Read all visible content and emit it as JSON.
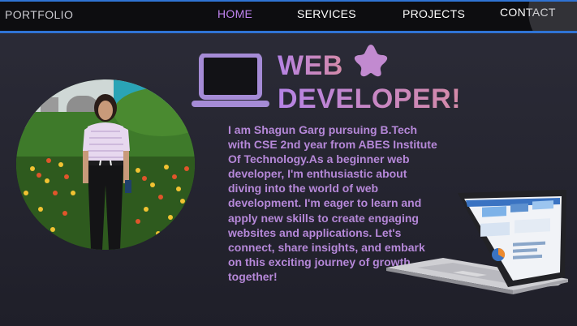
{
  "navbar": {
    "brand": "PORTFOLIO",
    "links": [
      {
        "label": "HOME",
        "active": true
      },
      {
        "label": "SERVICES",
        "active": false
      },
      {
        "label": "PROJECTS",
        "active": false
      },
      {
        "label": "CONTACT",
        "active": false
      }
    ],
    "border_color": "#2f73d4",
    "active_color": "#c084f0"
  },
  "hero": {
    "headline_line1": "WEB",
    "headline_line2": "DEVELOPER!",
    "bio": "I am Shagun Garg pursuing B.Tech with CSE 2nd year from ABES Institute Of Technology.As a beginner web developer, I'm enthusiastic about diving into the world of web development. I'm eager to learn and apply new skills to create engaging websites and applications. Let's connect, share insights, and embark on this exciting journey of growth together!",
    "icons": [
      "monitor-icon",
      "star-icon",
      "laptop-illustration"
    ],
    "colors": {
      "headline_start": "#b583e6",
      "headline_end": "#d48aa8",
      "bio_text": "#b688d9",
      "background": "#262631"
    }
  }
}
